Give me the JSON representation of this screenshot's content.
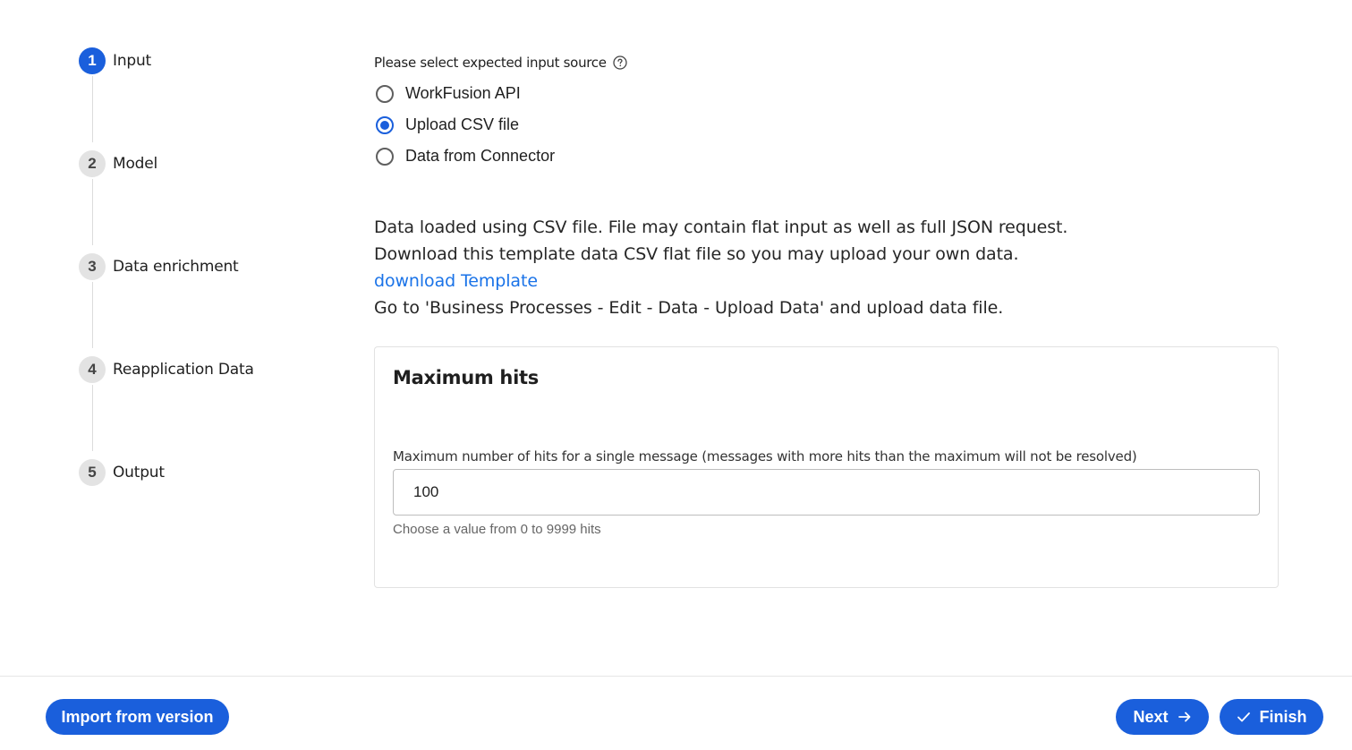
{
  "stepper": {
    "steps": [
      {
        "number": "1",
        "label": "Input",
        "active": true
      },
      {
        "number": "2",
        "label": "Model",
        "active": false
      },
      {
        "number": "3",
        "label": "Data enrichment",
        "active": false
      },
      {
        "number": "4",
        "label": "Reapplication Data",
        "active": false
      },
      {
        "number": "5",
        "label": "Output",
        "active": false
      }
    ]
  },
  "input_source": {
    "label": "Please select expected input source",
    "help_icon": "help-circle-icon",
    "options": [
      {
        "label": "WorkFusion API",
        "checked": false
      },
      {
        "label": "Upload CSV file",
        "checked": true
      },
      {
        "label": "Data from Connector",
        "checked": false
      }
    ],
    "selected": "Upload CSV file"
  },
  "description": {
    "line1": "Data loaded using CSV file. File may contain flat input as well as full JSON request.",
    "line2": "Download this template data CSV flat file so you may upload your own data.",
    "link": "download Template",
    "line3": "Go to 'Business Processes - Edit - Data - Upload Data' and upload data file."
  },
  "max_hits": {
    "title": "Maximum hits",
    "field_label": "Maximum number of hits for a single message (messages with more hits than the maximum will not be resolved)",
    "value": "100",
    "hint": "Choose a value from 0 to 9999 hits"
  },
  "footer": {
    "import_label": "Import from version",
    "next_label": "Next",
    "finish_label": "Finish"
  },
  "colors": {
    "accent": "#1a5fdc",
    "link": "#1a73e8"
  }
}
